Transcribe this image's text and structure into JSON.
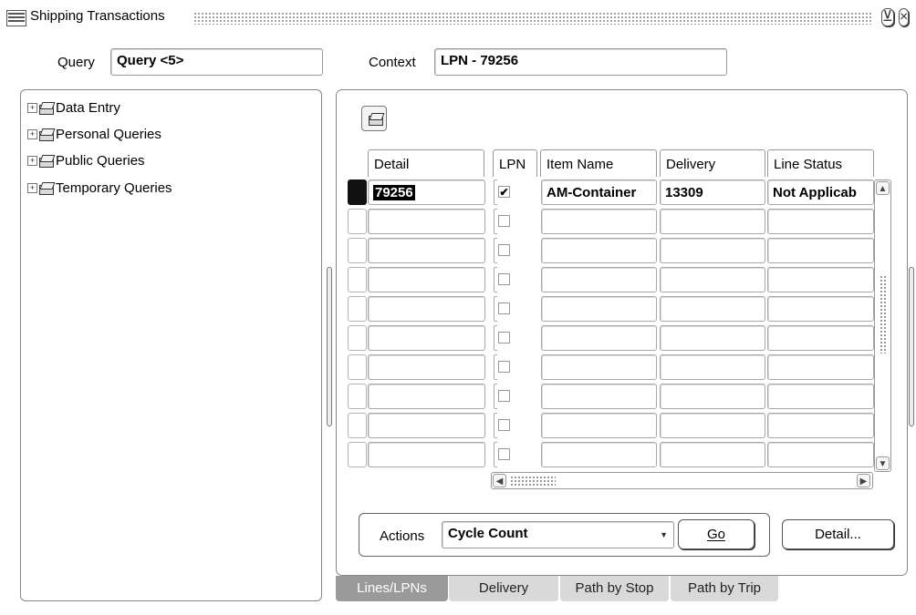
{
  "window": {
    "title": "Shipping Transactions",
    "logo_icon": "oracle-logo-icon",
    "minimize_glyph": "⊻",
    "close_glyph": "×"
  },
  "query": {
    "label": "Query",
    "value": "Query <5>"
  },
  "context": {
    "label": "Context",
    "value": "LPN - 79256"
  },
  "tree": {
    "items": [
      {
        "label": "Data Entry"
      },
      {
        "label": "Personal Queries"
      },
      {
        "label": "Public Queries"
      },
      {
        "label": "Temporary Queries"
      }
    ]
  },
  "table": {
    "headers": {
      "detail": "Detail",
      "lpn": "LPN",
      "item_name": "Item Name",
      "delivery": "Delivery",
      "line_status": "Line Status"
    },
    "rows": [
      {
        "detail": "79256",
        "lpn_checked": true,
        "item_name": "AM-Container",
        "delivery": "13309",
        "line_status": "Not Applicab"
      },
      {
        "detail": "",
        "lpn_checked": false,
        "item_name": "",
        "delivery": "",
        "line_status": ""
      },
      {
        "detail": "",
        "lpn_checked": false,
        "item_name": "",
        "delivery": "",
        "line_status": ""
      },
      {
        "detail": "",
        "lpn_checked": false,
        "item_name": "",
        "delivery": "",
        "line_status": ""
      },
      {
        "detail": "",
        "lpn_checked": false,
        "item_name": "",
        "delivery": "",
        "line_status": ""
      },
      {
        "detail": "",
        "lpn_checked": false,
        "item_name": "",
        "delivery": "",
        "line_status": ""
      },
      {
        "detail": "",
        "lpn_checked": false,
        "item_name": "",
        "delivery": "",
        "line_status": ""
      },
      {
        "detail": "",
        "lpn_checked": false,
        "item_name": "",
        "delivery": "",
        "line_status": ""
      },
      {
        "detail": "",
        "lpn_checked": false,
        "item_name": "",
        "delivery": "",
        "line_status": ""
      },
      {
        "detail": "",
        "lpn_checked": false,
        "item_name": "",
        "delivery": "",
        "line_status": ""
      }
    ]
  },
  "actions": {
    "label": "Actions",
    "selected": "Cycle Count",
    "go_label": "Go",
    "detail_label": "Detail..."
  },
  "tabs": [
    {
      "label": "Lines/LPNs",
      "active": true
    },
    {
      "label": "Delivery",
      "active": false
    },
    {
      "label": "Path by Stop",
      "active": false
    },
    {
      "label": "Path by Trip",
      "active": false
    }
  ],
  "colors": {
    "selected_row_indicator": "#111111",
    "active_tab": "#9a9a9a",
    "inactive_tab": "#d9d9d9"
  }
}
